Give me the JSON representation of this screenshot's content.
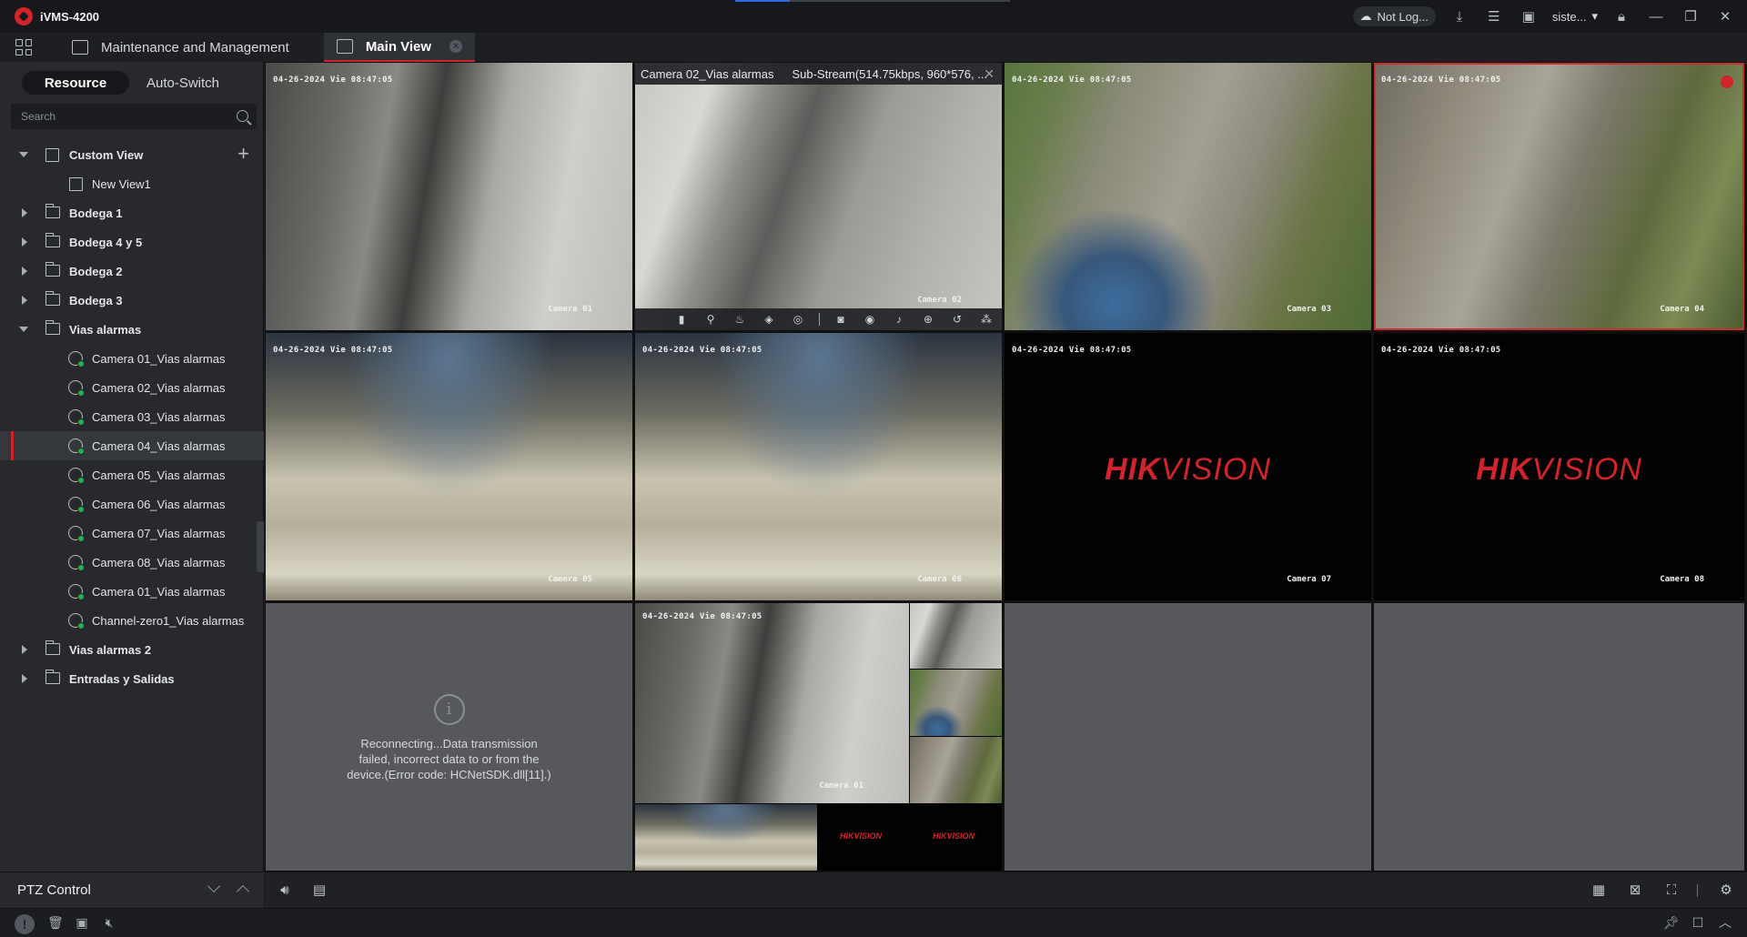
{
  "app": {
    "title": "iVMS-4200"
  },
  "titlebar": {
    "cloud_status": "Not Log...",
    "user": "siste...",
    "icons": [
      "download-icon",
      "task-list-icon",
      "image-icon",
      "lock-icon",
      "minimize-icon",
      "restore-icon",
      "close-icon"
    ]
  },
  "tabs": [
    {
      "label": "Maintenance and Management",
      "active": false
    },
    {
      "label": "Main View",
      "active": true
    }
  ],
  "left_panel": {
    "segments": [
      "Resource",
      "Auto-Switch"
    ],
    "active_segment": "Resource",
    "search_placeholder": "Search",
    "tree": [
      {
        "label": "Custom View",
        "type": "view-group",
        "expanded": true
      },
      {
        "label": "New View1",
        "type": "view",
        "level": 1
      },
      {
        "label": "Bodega 1",
        "type": "folder",
        "expanded": false
      },
      {
        "label": "Bodega 4 y 5",
        "type": "folder",
        "expanded": false
      },
      {
        "label": "Bodega 2",
        "type": "folder",
        "expanded": false
      },
      {
        "label": "Bodega 3",
        "type": "folder",
        "expanded": false
      },
      {
        "label": "Vias alarmas",
        "type": "folder",
        "expanded": true
      },
      {
        "label": "Camera 01_Vias alarmas",
        "type": "camera",
        "level": 1
      },
      {
        "label": "Camera 02_Vias alarmas",
        "type": "camera",
        "level": 1
      },
      {
        "label": "Camera 03_Vias alarmas",
        "type": "camera",
        "level": 1
      },
      {
        "label": "Camera 04_Vias alarmas",
        "type": "camera",
        "level": 1,
        "selected": true
      },
      {
        "label": "Camera 05_Vias alarmas",
        "type": "camera",
        "level": 1
      },
      {
        "label": "Camera 06_Vias alarmas",
        "type": "camera",
        "level": 1
      },
      {
        "label": "Camera 07_Vias alarmas",
        "type": "camera",
        "level": 1
      },
      {
        "label": "Camera 08_Vias alarmas",
        "type": "camera",
        "level": 1
      },
      {
        "label": "Camera 01_Vias alarmas",
        "type": "camera",
        "level": 1
      },
      {
        "label": "Channel-zero1_Vias alarmas",
        "type": "camera",
        "level": 1
      },
      {
        "label": "Vias alarmas 2",
        "type": "folder",
        "expanded": false
      },
      {
        "label": "Entradas y Salidas",
        "type": "folder",
        "expanded": false
      }
    ],
    "ptz_label": "PTZ Control"
  },
  "tiles": [
    {
      "ts": "04-26-2024 Vie 08:47:05",
      "name": "Camera 01"
    },
    {
      "ts": "",
      "name": "Camera 02",
      "header_title": "Camera 02_Vias alarmas",
      "header_stream": "Sub-Stream(514.75kbps, 960*576, ..."
    },
    {
      "ts": "04-26-2024 Vie 08:47:05",
      "name": "Camera 03"
    },
    {
      "ts": "04-26-2024 Vie 08:47:05",
      "name": "Camera 04"
    },
    {
      "ts": "04-26-2024 Vie 08:47:05",
      "name": "Camera 05"
    },
    {
      "ts": "04-26-2024 Vie 08:47:05",
      "name": "Camera 06"
    },
    {
      "ts": "04-26-2024 Vie 08:47:05",
      "name": "Camera 07"
    },
    {
      "ts": "04-26-2024 Vie 08:47:05",
      "name": "Camera 08"
    }
  ],
  "hikvision": {
    "hik": "HIK",
    "vision": "VISION"
  },
  "error_tile": {
    "message": "Reconnecting...Data transmission failed, incorrect data to or from the device.(Error code: HCNetSDK.dll[11].)"
  },
  "channel_zero": {
    "ts": "04-26-2024 Vie 08:47:05",
    "name": "Camera 01"
  },
  "tile_toolbar_icons": [
    "bookmark-icon",
    "ptz-icon",
    "fire-icon",
    "alarm-icon",
    "speed-dome-icon",
    "capture-icon",
    "record-icon",
    "audio-icon",
    "zoom-icon",
    "playback-icon",
    "more-icon"
  ],
  "bottom_toolbar_icons": [
    "volume-icon",
    "record-all-icon",
    "layout-icon",
    "close-all-icon",
    "fullscreen-icon",
    "settings-icon"
  ],
  "statusbar_icons": [
    "warning-icon",
    "delete-icon",
    "snapshot-icon",
    "mute-icon",
    "pin-icon",
    "window-icon",
    "expand-up-icon"
  ]
}
